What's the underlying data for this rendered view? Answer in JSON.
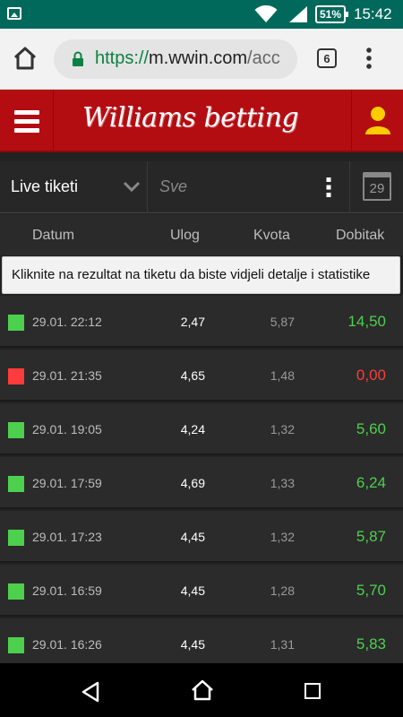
{
  "status_bar": {
    "time": "15:42",
    "battery": "51%"
  },
  "browser": {
    "url_scheme": "https://",
    "url_host": "m.wwin.com",
    "url_rest": "/acc",
    "tab_count": "6"
  },
  "site": {
    "logo": "Williams betting"
  },
  "filters": {
    "type_label": "Live tiketi",
    "status_value": "Sve",
    "calendar_day": "29"
  },
  "table": {
    "headers": {
      "date": "Datum",
      "stake": "Ulog",
      "odds": "Kvota",
      "win": "Dobitak"
    },
    "info": "Kliknite na rezultat na tiketu da biste vidjeli detalje i statistike",
    "rows": [
      {
        "date": "29.01. 22:12",
        "stake": "2,47",
        "odds": "5,87",
        "win": "14,50",
        "status": "won"
      },
      {
        "date": "29.01. 21:35",
        "stake": "4,65",
        "odds": "1,48",
        "win": "0,00",
        "status": "lost"
      },
      {
        "date": "29.01. 19:05",
        "stake": "4,24",
        "odds": "1,32",
        "win": "5,60",
        "status": "won"
      },
      {
        "date": "29.01. 17:59",
        "stake": "4,69",
        "odds": "1,33",
        "win": "6,24",
        "status": "won"
      },
      {
        "date": "29.01. 17:23",
        "stake": "4,45",
        "odds": "1,32",
        "win": "5,87",
        "status": "won"
      },
      {
        "date": "29.01. 16:59",
        "stake": "4,45",
        "odds": "1,28",
        "win": "5,70",
        "status": "won"
      },
      {
        "date": "29.01. 16:26",
        "stake": "4,45",
        "odds": "1,31",
        "win": "5,83",
        "status": "won"
      }
    ]
  },
  "colors": {
    "won": "#4dd04d",
    "lost": "#ff3b3b",
    "header_red": "#b30d12"
  }
}
